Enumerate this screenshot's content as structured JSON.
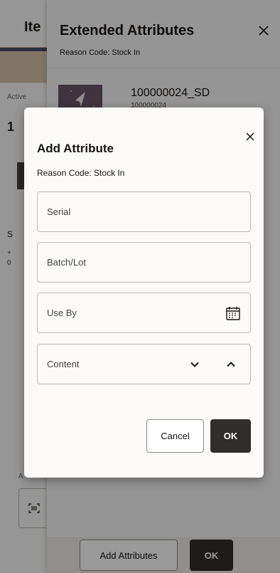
{
  "base": {
    "title": "Ite",
    "active_label": "Active",
    "big_value": "1",
    "s_label": "S",
    "small1": "+",
    "small2": "0",
    "ac_label": "A",
    "scan_icon": "barcode-scan-icon"
  },
  "drawer": {
    "title": "Extended Attributes",
    "subtitle": "Reason Code: Stock In",
    "close_icon": "close-icon",
    "item": {
      "title": "100000024_SD",
      "subtitle": "100000024"
    },
    "footer": {
      "add_attributes_label": "Add Attributes",
      "ok_label": "OK"
    }
  },
  "dialog": {
    "title": "Add Attribute",
    "subtitle": "Reason Code: Stock In",
    "close_icon": "close-icon",
    "fields": {
      "serial": {
        "placeholder": "Serial",
        "value": ""
      },
      "batch": {
        "placeholder": "Batch/Lot",
        "value": ""
      },
      "use_by": {
        "placeholder": "Use By",
        "value": "",
        "icon": "calendar-icon"
      },
      "content": {
        "placeholder": "Content",
        "value": "",
        "down_icon": "chevron-down-icon",
        "up_icon": "chevron-up-icon"
      }
    },
    "cancel_label": "Cancel",
    "ok_label": "OK"
  },
  "colors": {
    "primary_button": "#312d2a",
    "scrim": "rgba(0,0,0,0.40)",
    "field_border": "#bdb9b4"
  }
}
